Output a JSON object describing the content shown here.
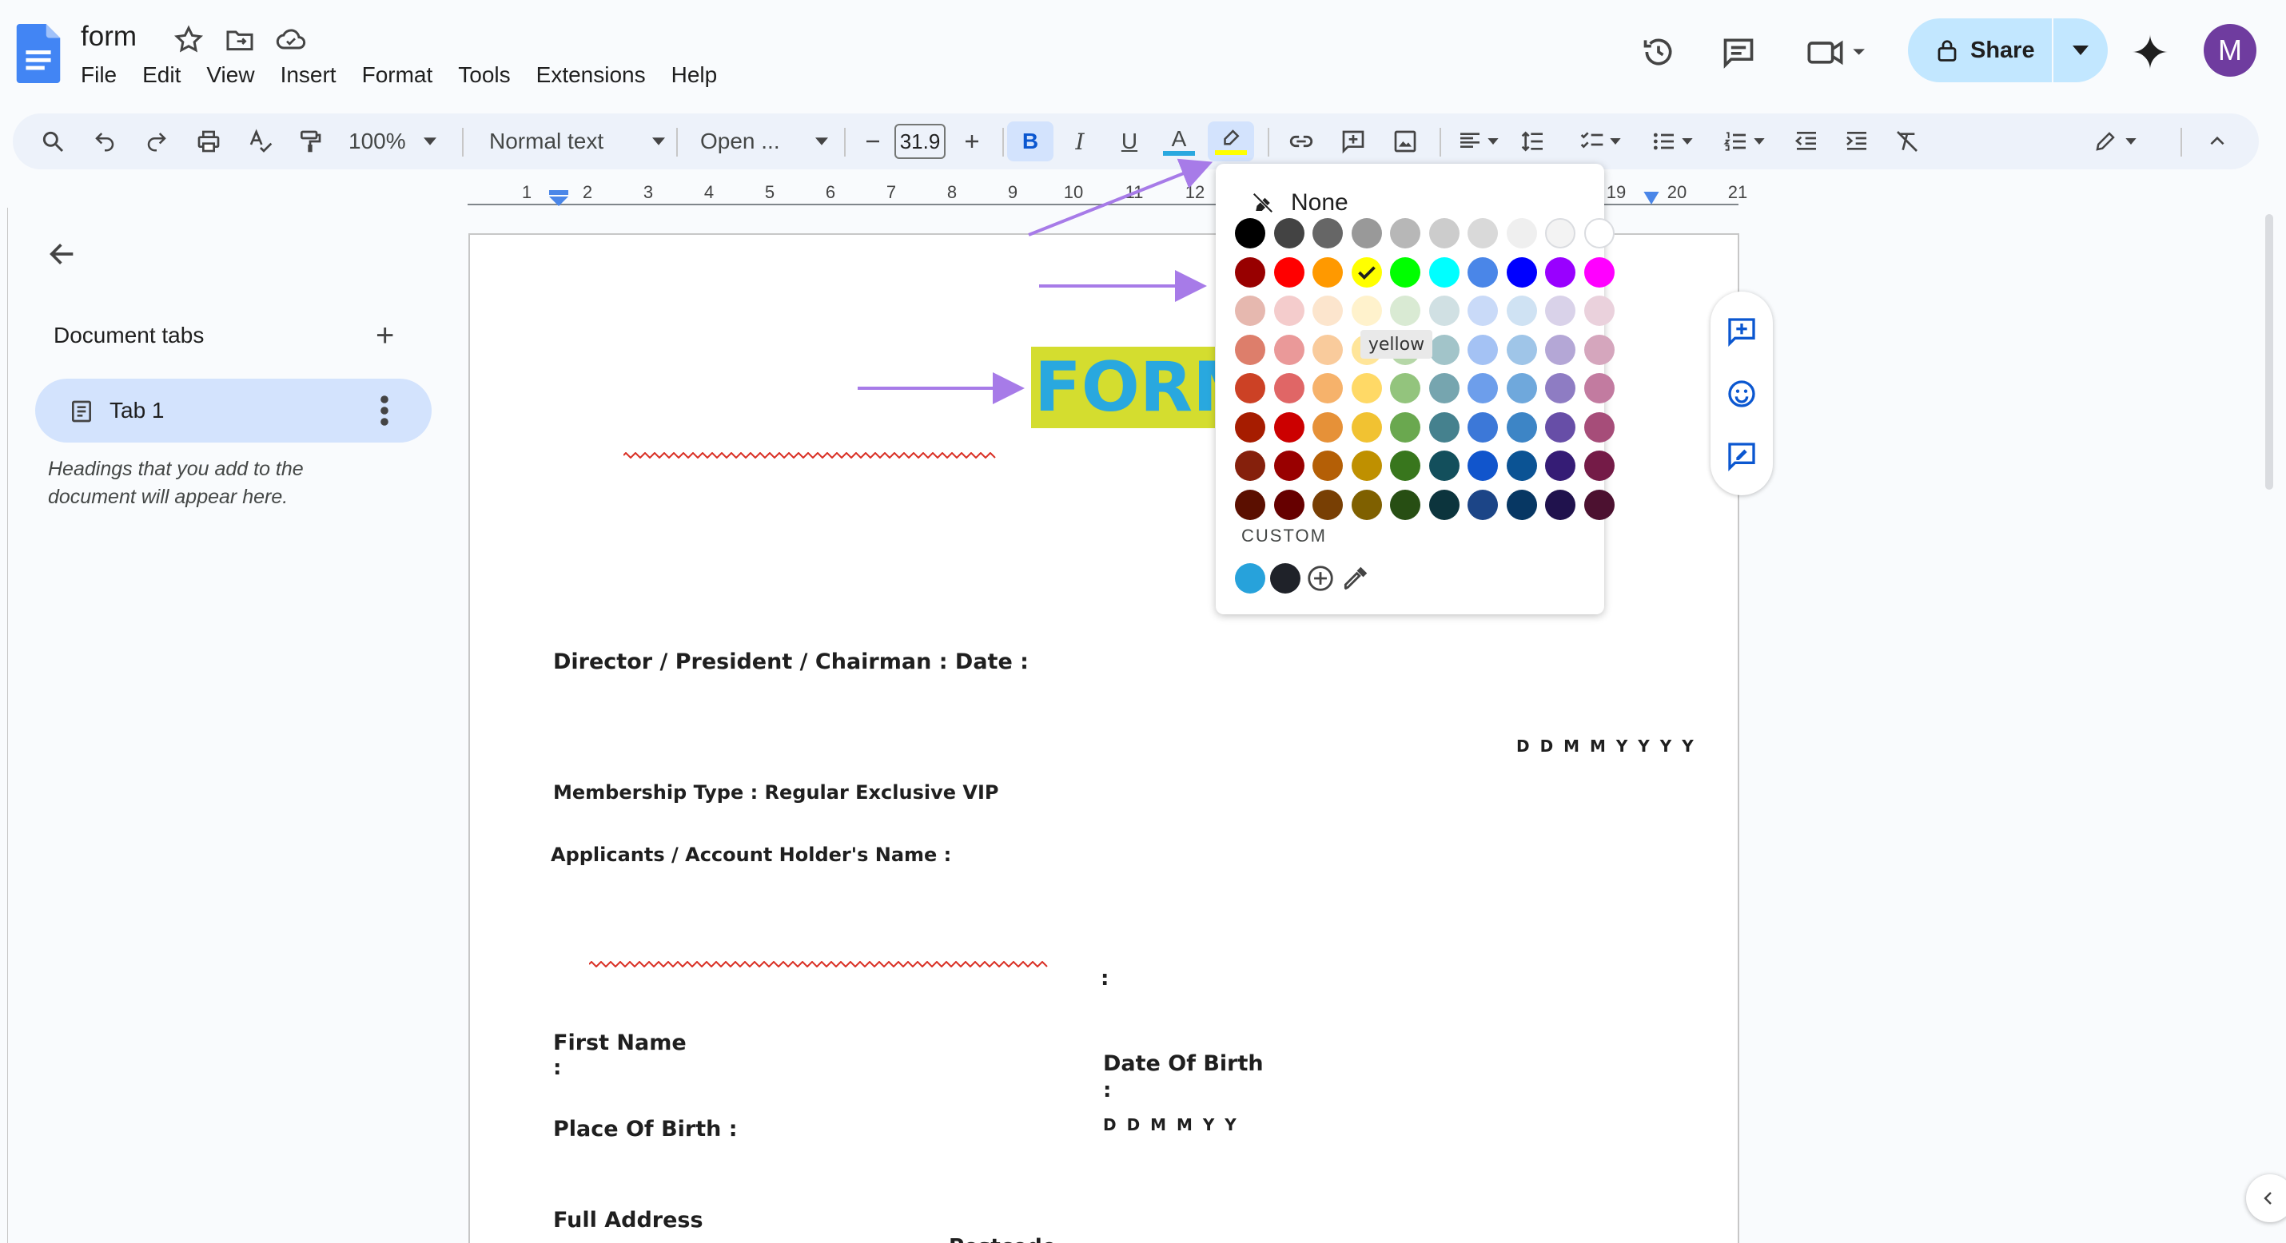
{
  "header": {
    "doc_title": "form",
    "menu": [
      "File",
      "Edit",
      "View",
      "Insert",
      "Format",
      "Tools",
      "Extensions",
      "Help"
    ],
    "share_label": "Share",
    "avatar_letter": "M"
  },
  "toolbar": {
    "zoom": "100%",
    "style": "Normal text",
    "font": "Open ...",
    "font_size": "31.9",
    "bold": "B",
    "italic": "I",
    "underline": "U",
    "text_color_letter": "A"
  },
  "ruler": {
    "numbers": [
      "1",
      "2",
      "3",
      "4",
      "5",
      "6",
      "7",
      "8",
      "9",
      "10",
      "11",
      "12",
      "19",
      "20",
      "21"
    ]
  },
  "sidebar": {
    "section_title": "Document tabs",
    "tab_label": "Tab 1",
    "hint": "Headings that you add to the document will appear here."
  },
  "picker": {
    "none_label": "None",
    "custom_label": "CUSTOM",
    "tooltip": "yellow",
    "selected": "yellow",
    "rows": [
      [
        "#000000",
        "#434343",
        "#666666",
        "#999999",
        "#b7b7b7",
        "#cccccc",
        "#d9d9d9",
        "#efefef",
        "#f3f3f3",
        "#ffffff"
      ],
      [
        "#980000",
        "#ff0000",
        "#ff9900",
        "#ffff00",
        "#00ff00",
        "#00ffff",
        "#4a86e8",
        "#0000ff",
        "#9900ff",
        "#ff00ff"
      ],
      [
        "#e6b8af",
        "#f4cccc",
        "#fce5cd",
        "#fff2cc",
        "#d9ead3",
        "#d0e0e3",
        "#c9daf8",
        "#cfe2f3",
        "#d9d2e9",
        "#ead1dc"
      ],
      [
        "#dd7e6b",
        "#ea9999",
        "#f9cb9c",
        "#ffe599",
        "#b6d7a8",
        "#a2c4c9",
        "#a4c2f4",
        "#9fc5e8",
        "#b4a7d6",
        "#d5a6bd"
      ],
      [
        "#cc4125",
        "#e06666",
        "#f6b26b",
        "#ffd966",
        "#93c47d",
        "#76a5af",
        "#6d9eeb",
        "#6fa8dc",
        "#8e7cc3",
        "#c27ba0"
      ],
      [
        "#a61c00",
        "#cc0000",
        "#e69138",
        "#f1c232",
        "#6aa84f",
        "#45818e",
        "#3c78d8",
        "#3d85c6",
        "#674ea7",
        "#a64d79"
      ],
      [
        "#85200c",
        "#990000",
        "#b45f06",
        "#bf9000",
        "#38761d",
        "#134f5c",
        "#1155cc",
        "#0b5394",
        "#351c75",
        "#741b47"
      ],
      [
        "#5b0f00",
        "#660000",
        "#783f04",
        "#7f6000",
        "#274e13",
        "#0c343d",
        "#1c4587",
        "#073763",
        "#20124d",
        "#4c1130"
      ]
    ],
    "custom_colors": [
      "#27a2db",
      "#1f2229"
    ]
  },
  "document": {
    "title_text": "FORM",
    "director": "Director / President / Chairman : Date :",
    "date_fmt1": "D D M M Y Y Y Y",
    "membership": "Membership Type : Regular Exclusive VIP",
    "applicant": "Applicants / Account Holder's Name :",
    "colon": ":",
    "first_name": "First Name",
    "first_name_colon": ":",
    "dob": "Date Of Birth",
    "dob_colon": ":",
    "place_of_birth": "Place Of Birth :",
    "date_fmt2": "D D M M Y Y",
    "full_address": "Full Address",
    "postcode": "Postcode"
  },
  "colors": {
    "accent": "#0b57d0",
    "share_bg": "#c2e7ff",
    "highlight": "#d4dd2f",
    "title_text": "#29a8df",
    "annotation_arrow": "#a77be8"
  }
}
